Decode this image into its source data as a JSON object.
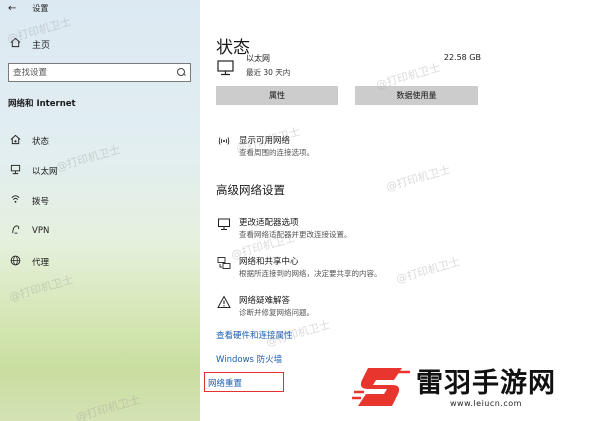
{
  "window": {
    "title": "设置"
  },
  "sidebar": {
    "home_label": "主页",
    "search_placeholder": "查找设置",
    "section_heading": "网络和 Internet",
    "items": [
      {
        "label": "状态",
        "icon": "home-status-icon"
      },
      {
        "label": "以太网",
        "icon": "ethernet-icon"
      },
      {
        "label": "拨号",
        "icon": "dialup-icon"
      },
      {
        "label": "VPN",
        "icon": "vpn-icon"
      },
      {
        "label": "代理",
        "icon": "globe-icon"
      }
    ]
  },
  "main": {
    "title": "状态",
    "connection": {
      "name": "以太网",
      "subtitle": "最近 30 天内",
      "data_usage": "22.58 GB"
    },
    "buttons": {
      "properties": "属性",
      "data_usage": "数据使用量"
    },
    "show_networks": {
      "title": "显示可用网络",
      "desc": "查看周围的连接选项。"
    },
    "advanced_heading": "高级网络设置",
    "advanced_items": [
      {
        "title": "更改适配器选项",
        "desc": "查看网络适配器并更改连接设置。"
      },
      {
        "title": "网络和共享中心",
        "desc": "根据所连接到的网络，决定要共享的内容。"
      },
      {
        "title": "网络疑难解答",
        "desc": "诊断并修复网络问题。"
      }
    ],
    "links": {
      "hardware": "查看硬件和连接属性",
      "firewall": "Windows 防火墙",
      "reset": "网络重置"
    }
  },
  "watermark_text": "@打印机卫士",
  "brand": {
    "name": "雷羽手游网",
    "url": "www.leiucn.com",
    "accent_color": "#e8352e"
  }
}
